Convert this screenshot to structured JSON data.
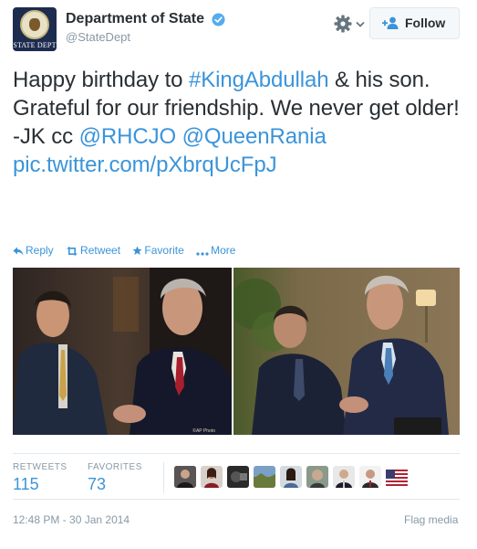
{
  "user": {
    "display_name": "Department of State",
    "screen_name": "@StateDept",
    "avatar_caption": "STATE DEPT",
    "verified_icon": "verified-check-icon"
  },
  "header": {
    "follow_label": "Follow",
    "settings_icon": "gear-icon",
    "dropdown_icon": "chevron-down-icon"
  },
  "tweet": {
    "text_1": "Happy birthday to ",
    "hashtag": "#KingAbdullah",
    "text_2": " & his son. Grateful for our friendship. We never get older! -JK cc ",
    "mention_1": "@RHCJO",
    "space": " ",
    "mention_2": "@QueenRania",
    "media_link": "pic.twitter.com/pXbrqUcFpJ"
  },
  "actions": [
    {
      "icon": "reply-icon",
      "label": "Reply"
    },
    {
      "icon": "retweet-icon",
      "label": "Retweet"
    },
    {
      "icon": "star-icon",
      "label": "Favorite"
    },
    {
      "icon": "more-dots-icon",
      "label": "More"
    }
  ],
  "media": {
    "photo_credit": "©AP Photo"
  },
  "stats": {
    "retweets_label": "RETWEETS",
    "retweets_value": "115",
    "favorites_label": "FAVORITES",
    "favorites_value": "73"
  },
  "favoriters": [
    {
      "name": "favoriter-avatar-1"
    },
    {
      "name": "favoriter-avatar-2"
    },
    {
      "name": "favoriter-avatar-3"
    },
    {
      "name": "favoriter-avatar-4"
    },
    {
      "name": "favoriter-avatar-5"
    },
    {
      "name": "favoriter-avatar-6"
    },
    {
      "name": "favoriter-avatar-7"
    },
    {
      "name": "favoriter-avatar-8"
    },
    {
      "name": "favoriter-avatar-9"
    }
  ],
  "footer": {
    "timestamp": "12:48 PM - 30 Jan 2014",
    "flag_media": "Flag media"
  },
  "colors": {
    "link": "#3b94d9",
    "text": "#292f33",
    "muted": "#8899a6",
    "verified": "#55acee"
  }
}
